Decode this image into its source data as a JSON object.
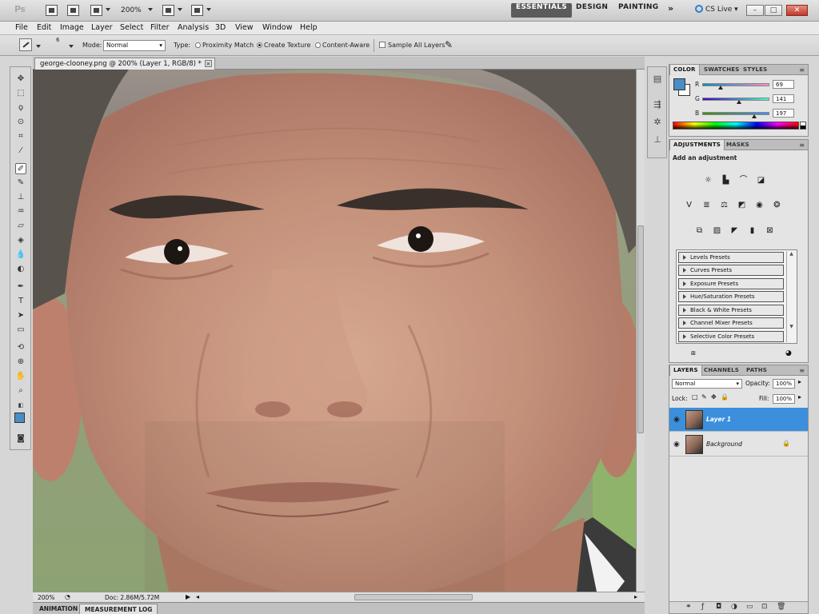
{
  "app": {
    "logo": "Ps",
    "zoom": "200%",
    "workspaces": [
      "ESSENTIALS",
      "DESIGN",
      "PAINTING"
    ],
    "more": "»",
    "cs_live": "CS Live",
    "window_buttons": [
      "–",
      "□",
      "✕"
    ]
  },
  "menu": [
    "File",
    "Edit",
    "Image",
    "Layer",
    "Select",
    "Filter",
    "Analysis",
    "3D",
    "View",
    "Window",
    "Help"
  ],
  "options": {
    "brush_size": "6",
    "mode_label": "Mode:",
    "mode_value": "Normal",
    "type_label": "Type:",
    "proximity": "Proximity Match",
    "create_texture": "Create Texture",
    "content_aware": "Content-Aware",
    "sample_all": "Sample All Layers"
  },
  "document": {
    "tab_title": "george-clooney.png @ 200% (Layer 1, RGB/8) *",
    "zoom": "200%",
    "doc_info": "Doc: 2.86M/5.72M"
  },
  "bottom_tabs": [
    "ANIMATION",
    "MEASUREMENT LOG"
  ],
  "color_panel": {
    "tabs": [
      "COLOR",
      "SWATCHES",
      "STYLES"
    ],
    "foreground": "#4a8dc4",
    "background": "#ffffff",
    "channels": [
      {
        "label": "R",
        "value": "69",
        "fraction": 0.27
      },
      {
        "label": "G",
        "value": "141",
        "fraction": 0.55
      },
      {
        "label": "B",
        "value": "197",
        "fraction": 0.77
      }
    ]
  },
  "adjustments": {
    "tabs": [
      "ADJUSTMENTS",
      "MASKS"
    ],
    "title": "Add an adjustment",
    "presets": [
      "Levels Presets",
      "Curves Presets",
      "Exposure Presets",
      "Hue/Saturation Presets",
      "Black & White Presets",
      "Channel Mixer Presets",
      "Selective Color Presets"
    ]
  },
  "layers": {
    "tabs": [
      "LAYERS",
      "CHANNELS",
      "PATHS"
    ],
    "blend_mode": "Normal",
    "opacity_label": "Opacity:",
    "opacity": "100%",
    "lock_label": "Lock:",
    "fill_label": "Fill:",
    "fill": "100%",
    "items": [
      {
        "name": "Layer 1"
      },
      {
        "name": "Background"
      }
    ]
  }
}
